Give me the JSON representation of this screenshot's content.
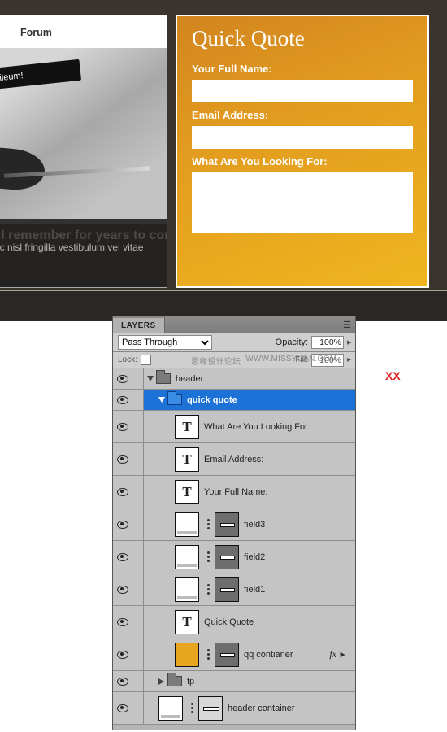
{
  "top": {
    "nav_forum": "Forum",
    "banner_text": "ubileum!",
    "ghost_heading": "'ll remember for years to come.",
    "body_line": "ec nisl fringilla vestibulum vel vitae"
  },
  "quote": {
    "title": "Quick Quote",
    "full_name_label": "Your Full Name:",
    "email_label": "Email Address:",
    "looking_label": "What Are You Looking For:"
  },
  "annotations": {
    "red_xx": "XX"
  },
  "panel": {
    "tab_label": "LAYERS",
    "blend_mode": "Pass Through",
    "opacity_label": "Opacity:",
    "opacity_value": "100%",
    "lock_label": "Lock:",
    "fill_label": "Fill:",
    "fill_value": "100%",
    "watermark1": "思缘设计论坛",
    "watermark2": "WWW.MISSYUAN.COM"
  },
  "layers": {
    "header": "header",
    "quick_quote": "quick quote",
    "l_looking": "What Are You Looking For:",
    "l_email": "Email Address:",
    "l_full": "Your Full Name:",
    "field3": "field3",
    "field2": "field2",
    "field1": "field1",
    "l_qq": "Quick Quote",
    "qq_container": "qq contianer",
    "fx": "fx",
    "fp": "fp",
    "hdr_container": "header container"
  }
}
